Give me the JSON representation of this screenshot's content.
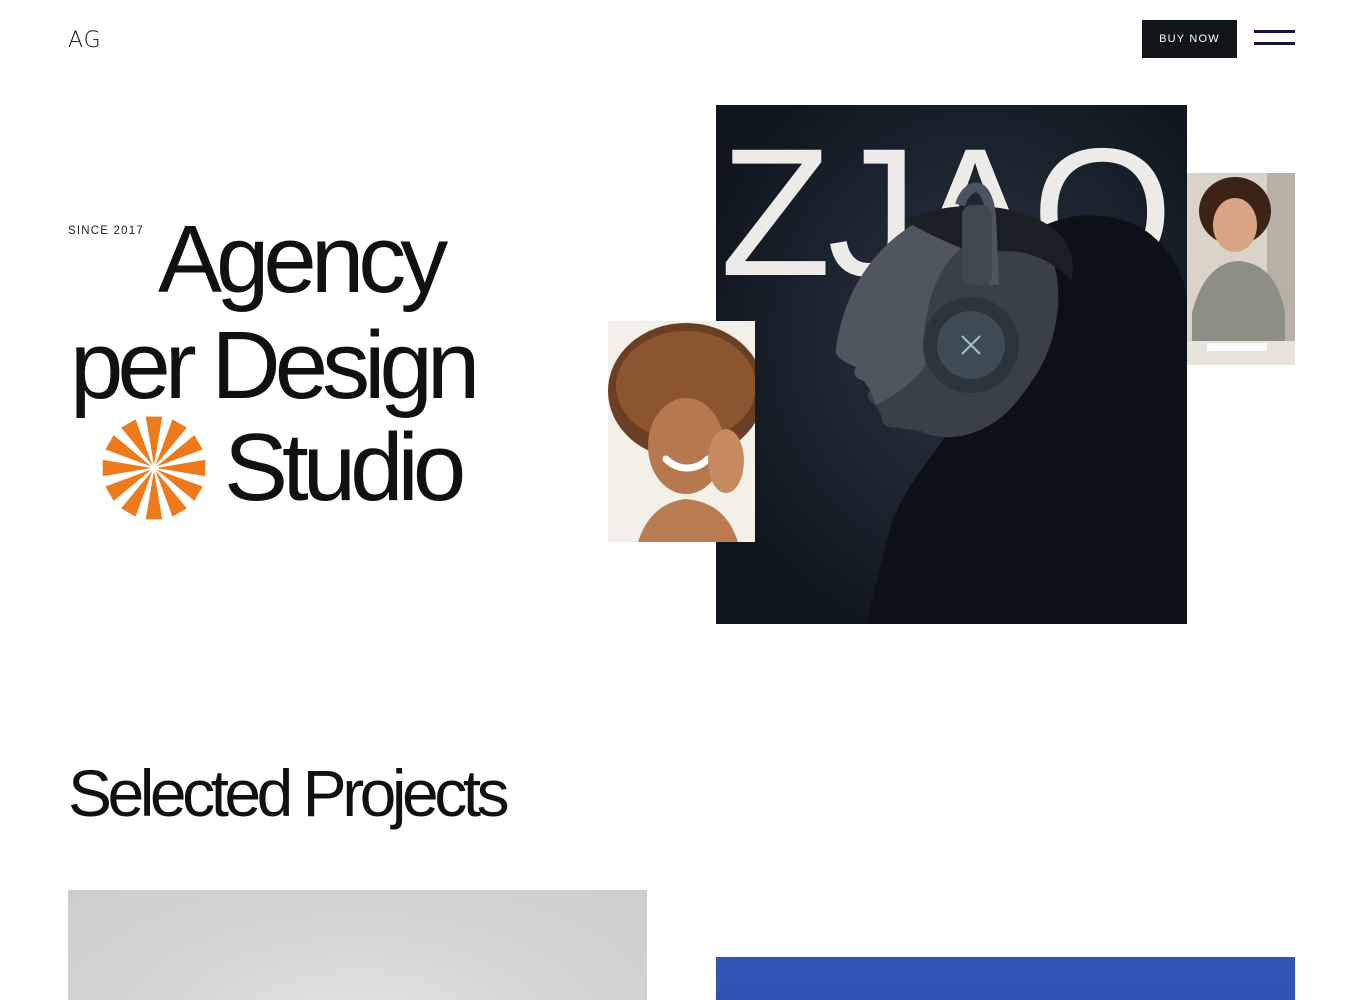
{
  "header": {
    "logo_text": "AG",
    "buy_label": "BUY NOW",
    "menu_icon": "hamburger-menu-icon"
  },
  "hero": {
    "since": "SINCE 2017",
    "headline_line1": "Agency",
    "headline_line2": "per Design",
    "headline_line3": "Studio",
    "star_icon": "orange-starburst-icon",
    "main_photo_text": "ZJAO"
  },
  "projects": {
    "title": "Selected Projects"
  },
  "colors": {
    "accent": "#ee7a1c",
    "dark": "#111418",
    "photo_bg": "#141c26",
    "project_blue": "#2f52b6"
  }
}
